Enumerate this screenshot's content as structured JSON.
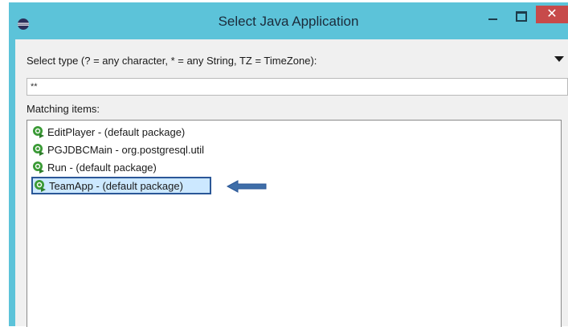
{
  "window": {
    "title": "Select Java Application",
    "close_glyph": "✕"
  },
  "filter": {
    "label": "Select type (? = any character, * = any String, TZ = TimeZone):",
    "value": "**"
  },
  "matching": {
    "label": "Matching items:",
    "items": [
      {
        "label": "EditPlayer - (default package)",
        "icon": "java-run-icon",
        "selected": false
      },
      {
        "label": "PGJDBCMain - org.postgresql.util",
        "icon": "java-run-icon",
        "selected": false
      },
      {
        "label": "Run - (default package)",
        "icon": "java-run-icon",
        "selected": false
      },
      {
        "label": "TeamApp - (default package)",
        "icon": "java-run-icon",
        "selected": true
      }
    ]
  },
  "colors": {
    "titlebar": "#5cc3d9",
    "close_button": "#c74a4a",
    "selection_border": "#2b5797",
    "selection_fill": "#cce8ff",
    "annotation_arrow": "#3f6ea8"
  }
}
